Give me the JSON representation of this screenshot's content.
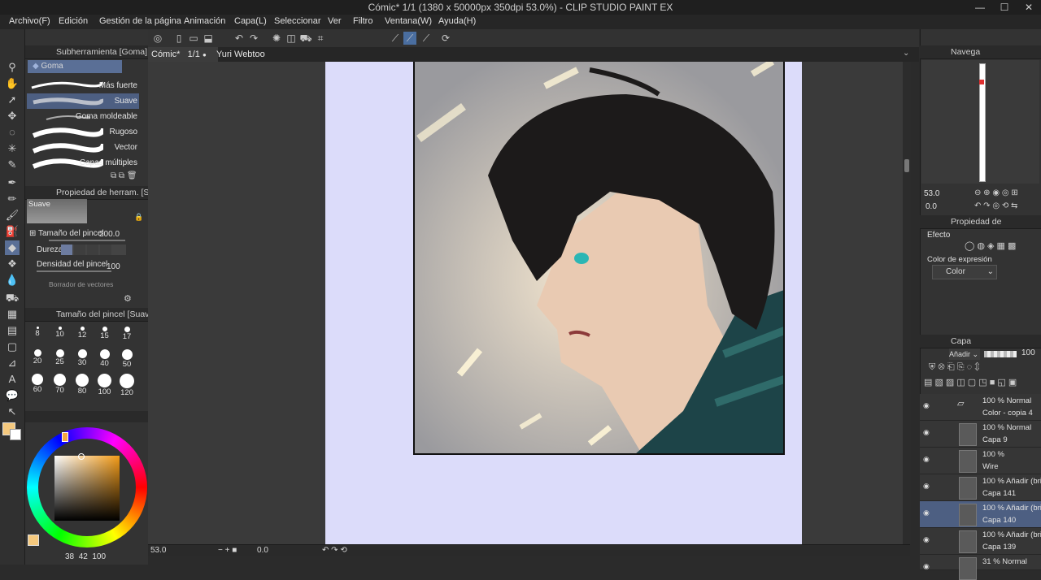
{
  "window": {
    "title": "Cómic* 1/1 (1380 x 50000px 350dpi 53.0%)  - CLIP STUDIO PAINT EX",
    "min": "—",
    "max": "☐",
    "close": "✕"
  },
  "menu": [
    "Archivo(F)",
    "Edición",
    "Gestión de la página",
    "Animación",
    "Capa(L)",
    "Seleccionar",
    "Ver",
    "Filtro",
    "Ventana(W)",
    "Ayuda(H)"
  ],
  "tabs": [
    {
      "label": "Cómic*",
      "page": "1/1",
      "dot": "●"
    },
    {
      "label": "Yuri Webtoo",
      "close": "✕"
    }
  ],
  "subtool_panel": {
    "title": "Subherramienta [Goma]",
    "group": "Goma",
    "items": [
      "Más fuerte",
      "Suave",
      "Goma moldeable",
      "Rugoso",
      "Vector",
      "Capas múltiples"
    ],
    "selected": "Suave"
  },
  "tool_property": {
    "title": "Propiedad de herram. [Su",
    "preview_label": "Suave",
    "brush_size_label": "Tamaño del pincel",
    "brush_size_value": "200.0",
    "hardness_label": "Dureza",
    "density_label": "Densidad del pincel",
    "density_value": "100",
    "vector_eraser_label": "Borrador de vectores"
  },
  "brush_size_panel": {
    "title": "Tamaño del pincel [Suav",
    "sizes": [
      "8",
      "10",
      "12",
      "15",
      "17",
      "20",
      "25",
      "30",
      "40",
      "50",
      "60",
      "70",
      "80",
      "100",
      "120"
    ]
  },
  "color_panel": {
    "values": [
      "38",
      "42",
      "100"
    ],
    "main_color": "#f5c97e",
    "sub_color": "#ffffff"
  },
  "status": {
    "zoom": "53.0",
    "angle": "0.0"
  },
  "navigator": {
    "title": "Navega",
    "zoom": "53.0",
    "angle": "0.0"
  },
  "layer_property": {
    "title": "Propiedad de",
    "effect_label": "Efecto",
    "expression_color_label": "Color de expresión",
    "expression_color_value": "Color"
  },
  "layer_panel": {
    "title": "Capa",
    "blend_mode": "Añadir",
    "opacity": "100",
    "layers": [
      {
        "line1": "100 % Normal",
        "line2": "Color - copia 4",
        "type": "folder"
      },
      {
        "line1": "100 % Normal",
        "line2": "Capa 9",
        "type": "raster"
      },
      {
        "line1": "100 %",
        "line2": "Wire",
        "type": "frame"
      },
      {
        "line1": "100 % Añadir (brill",
        "line2": "Capa 141",
        "type": "raster"
      },
      {
        "line1": "100 % Añadir (brill",
        "line2": "Capa 140",
        "type": "raster",
        "selected": true
      },
      {
        "line1": "100 % Añadir (brill",
        "line2": "Capa 139",
        "type": "raster"
      },
      {
        "line1": "31 % Normal",
        "line2": "",
        "type": "raster"
      }
    ]
  },
  "colors": {
    "accent": "#4d5f82",
    "page": "#dcdcfa",
    "panel": "#333333"
  }
}
